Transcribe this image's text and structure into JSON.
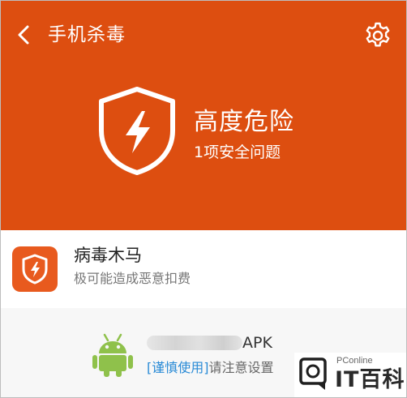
{
  "header": {
    "back_icon": "chevron-left-icon",
    "title": "手机杀毒",
    "settings_icon": "gear-icon"
  },
  "status": {
    "icon": "shield-lightning-icon",
    "level": "高度危险",
    "summary": "1项安全问题"
  },
  "threat": {
    "icon": "shield-lightning-icon",
    "name": "病毒木马",
    "description": "极可能造成恶意扣费"
  },
  "app_item": {
    "icon": "android-icon",
    "name_suffix": "APK",
    "tag": "[谨慎使用]",
    "note": "请注意设置"
  },
  "watermark": {
    "brand_small": "PConline",
    "brand_big": "IT百科"
  },
  "colors": {
    "hero_background": "#dd4e10",
    "threat_icon_background": "#e85a1e",
    "tag_blue": "#2a8bd6",
    "android_green": "#8fc14b"
  }
}
